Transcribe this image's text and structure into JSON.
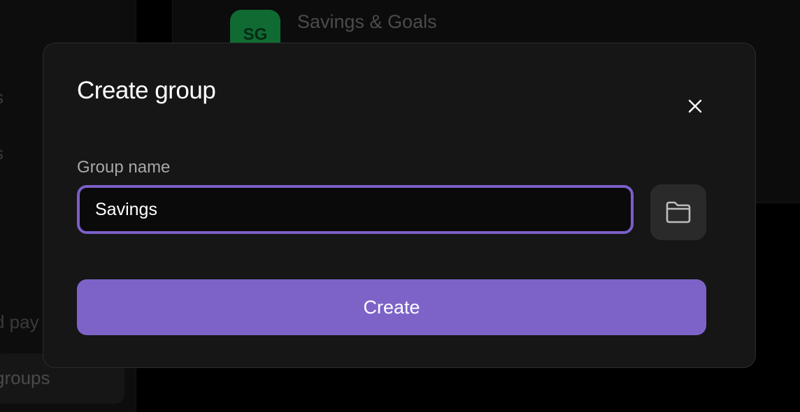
{
  "background": {
    "sidebar": {
      "items": [
        {
          "label": "s"
        },
        {
          "label": "s"
        },
        {
          "label": "d pay"
        },
        {
          "label": "groups"
        }
      ]
    },
    "group_card": {
      "avatar_initials": "SG",
      "avatar_color": "#0f6b32",
      "title": "Savings & Goals"
    }
  },
  "modal": {
    "title": "Create group",
    "close_icon": "close-icon",
    "field": {
      "label": "Group name",
      "value": "Savings"
    },
    "folder_icon": "folder-icon",
    "submit_label": "Create"
  },
  "colors": {
    "accent": "#7d63c8",
    "input_border": "#7b5fc8",
    "modal_bg": "#161616"
  }
}
